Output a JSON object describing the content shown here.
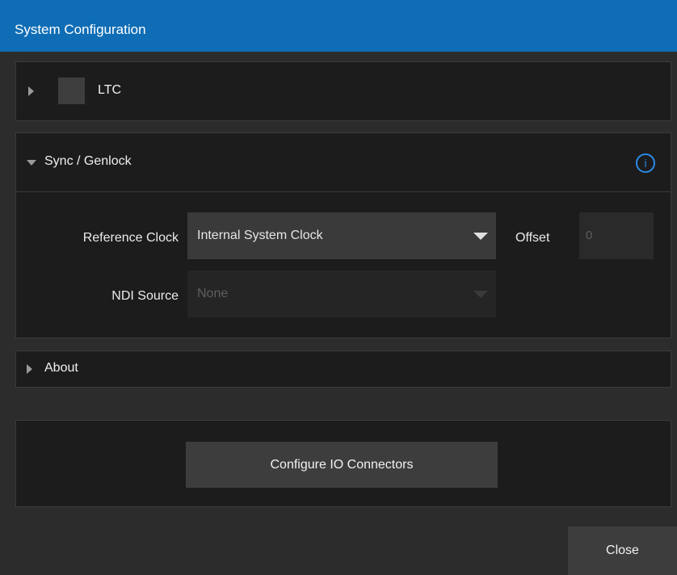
{
  "window": {
    "title": "System Configuration"
  },
  "ltc": {
    "label": "LTC"
  },
  "sync": {
    "label": "Sync / Genlock",
    "info_icon": "i",
    "reference_clock": {
      "label": "Reference Clock",
      "value": "Internal System Clock"
    },
    "offset": {
      "label": "Offset",
      "value": "0"
    },
    "ndi_source": {
      "label": "NDI Source",
      "value": "None"
    }
  },
  "about": {
    "label": "About"
  },
  "configure_io": {
    "label": "Configure IO Connectors"
  },
  "footer": {
    "close_label": "Close"
  },
  "colors": {
    "titlebar": "#0f6db5",
    "info_accent": "#2a8ae8"
  }
}
